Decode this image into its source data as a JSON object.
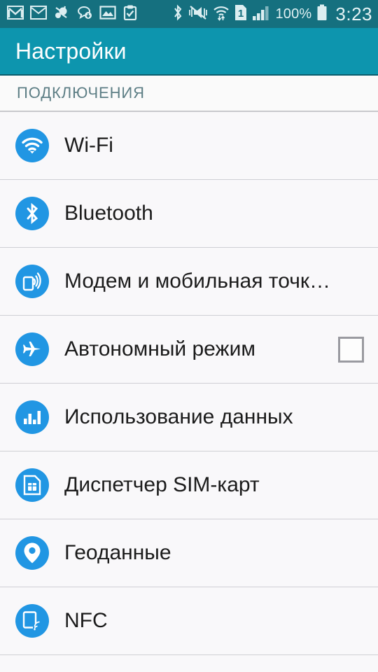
{
  "statusbar": {
    "left_icons": [
      {
        "name": "gmail-icon"
      },
      {
        "name": "email-icon"
      },
      {
        "name": "swarm-icon"
      },
      {
        "name": "chat-download-icon"
      },
      {
        "name": "gallery-image-icon"
      },
      {
        "name": "clipboard-check-icon"
      }
    ],
    "right_icons": [
      {
        "name": "bluetooth-icon"
      },
      {
        "name": "vibrate-mute-icon"
      },
      {
        "name": "wifi-transfer-icon"
      },
      {
        "name": "sim-one-icon"
      },
      {
        "name": "signal-bars-icon"
      }
    ],
    "battery_percent": "100%",
    "battery_icon": "battery-full-icon",
    "clock": "3:23"
  },
  "actionbar": {
    "title": "Настройки",
    "background": "#0d95ae"
  },
  "section": {
    "label": "ПОДКЛЮЧЕНИЯ"
  },
  "colors": {
    "accent_icon": "#2196e3",
    "statusbar": "#15707f",
    "actionbar": "#0d95ae",
    "list_background": "#f9f8fa",
    "divider": "#cfcfd4",
    "label_text": "#1b1b1b",
    "section_text": "#5d7e85"
  },
  "list": {
    "items": [
      {
        "label": "Wi-Fi",
        "icon": "wifi-icon",
        "has_checkbox": false
      },
      {
        "label": "Bluetooth",
        "icon": "bluetooth-icon",
        "has_checkbox": false
      },
      {
        "label": "Модем и мобильная точк…",
        "icon": "tethering-icon",
        "has_checkbox": false
      },
      {
        "label": "Автономный режим",
        "icon": "airplane-icon",
        "has_checkbox": true,
        "checked": false
      },
      {
        "label": "Использование данных",
        "icon": "data-usage-icon",
        "has_checkbox": false
      },
      {
        "label": "Диспетчер SIM-карт",
        "icon": "sim-card-icon",
        "has_checkbox": false
      },
      {
        "label": "Геоданные",
        "icon": "location-pin-icon",
        "has_checkbox": false
      },
      {
        "label": "NFC",
        "icon": "nfc-icon",
        "has_checkbox": false
      }
    ]
  }
}
